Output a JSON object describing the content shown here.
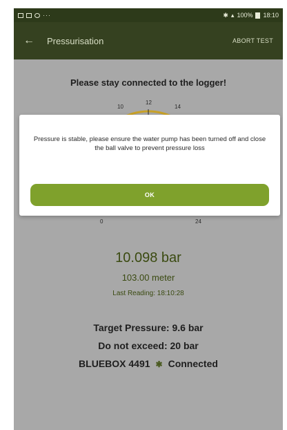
{
  "status_bar": {
    "left_dots": "···",
    "right_text": "100%",
    "time": "18:10"
  },
  "app_bar": {
    "back_icon": "arrow-left-icon",
    "title": "Pressurisation",
    "abort_label": "ABORT TEST"
  },
  "main": {
    "headline": "Please stay connected to the logger!",
    "gauge": {
      "ticks_top": [
        "10",
        "12",
        "14"
      ],
      "ticks_bottom": [
        "0",
        "24"
      ]
    },
    "reading": "10.098 bar",
    "meter": "103.00 meter",
    "last_reading": "Last Reading: 18:10:28",
    "target": "Target Pressure: 9.6 bar",
    "exceed": "Do not exceed: 20 bar",
    "device_name": "BLUEBOX 4491",
    "device_status": "Connected"
  },
  "dialog": {
    "message": "Pressure is stable, please ensure the water pump has been turned off and close the ball valve to prevent pressure loss",
    "ok_label": "OK"
  },
  "colors": {
    "app_bar": "#354120",
    "accent": "#7fa12c",
    "reading_text": "#3a4a10"
  }
}
